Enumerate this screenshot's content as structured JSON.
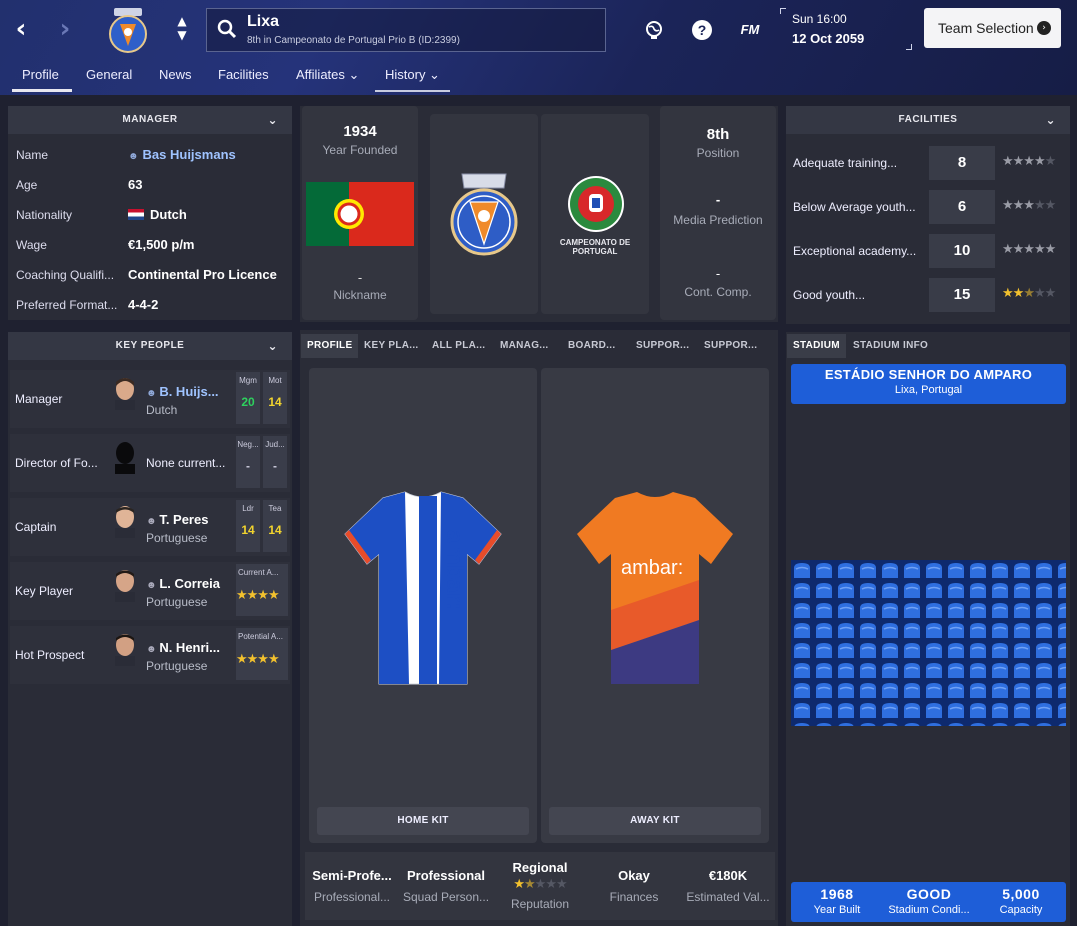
{
  "header": {
    "club_name": "Lixa",
    "club_subtitle": "8th in Campeonato de Portugal Prio B (ID:2399)",
    "fm_label": "FM",
    "help_label": "?",
    "time": "Sun 16:00",
    "date": "12 Oct 2059",
    "team_selection": "Team Selection"
  },
  "tabs": [
    {
      "label": "Profile",
      "active": true
    },
    {
      "label": "General"
    },
    {
      "label": "News"
    },
    {
      "label": "Facilities"
    },
    {
      "label": "Affiliates ⌄"
    },
    {
      "label": "History ⌄"
    }
  ],
  "manager_panel": {
    "title": "MANAGER",
    "rows": [
      {
        "label": "Name",
        "value": "Bas Huijsmans"
      },
      {
        "label": "Age",
        "value": "63"
      },
      {
        "label": "Nationality",
        "value": "Dutch"
      },
      {
        "label": "Wage",
        "value": "€1,500 p/m"
      },
      {
        "label": "Coaching Qualifi...",
        "value": "Continental Pro Licence"
      },
      {
        "label": "Preferred Format...",
        "value": "4-4-2"
      }
    ]
  },
  "club_info": {
    "year_founded": "1934",
    "year_founded_label": "Year Founded",
    "nickname": "-",
    "nickname_label": "Nickname",
    "position": "8th",
    "position_label": "Position",
    "media_prediction": "-",
    "media_prediction_label": "Media Prediction",
    "cont_comp": "-",
    "cont_comp_label": "Cont. Comp.",
    "league_logo_text": "CAMPEONATO DE PORTUGAL"
  },
  "facilities_panel": {
    "title": "FACILITIES",
    "rows": [
      {
        "label": "Adequate training...",
        "value": "8",
        "stars": 4
      },
      {
        "label": "Below Average youth...",
        "value": "6",
        "stars": 3
      },
      {
        "label": "Exceptional academy...",
        "value": "10",
        "stars": 5
      },
      {
        "label": "Good youth...",
        "value": "15",
        "stars": 2.5
      }
    ]
  },
  "key_people": {
    "title": "KEY PEOPLE",
    "rows": [
      {
        "role": "Manager",
        "name": "B. Huijs...",
        "nationality": "Dutch",
        "a1_head": "Mgm",
        "a1": "20",
        "a2_head": "Mot",
        "a2": "14"
      },
      {
        "role": "Director of Fo...",
        "none": "None current...",
        "a1_head": "Neg...",
        "a1": "-",
        "a2_head": "Jud...",
        "a2": "-"
      },
      {
        "role": "Captain",
        "name": "T. Peres",
        "nationality": "Portuguese",
        "a1_head": "Ldr",
        "a1": "14",
        "a2_head": "Tea",
        "a2": "14"
      },
      {
        "role": "Key Player",
        "name": "L. Correia",
        "nationality": "Portuguese",
        "wide_head": "Current A...",
        "stars": "★★★★"
      },
      {
        "role": "Hot Prospect",
        "name": "N. Henri...",
        "nationality": "Portuguese",
        "wide_head": "Potential A...",
        "stars": "★★★★"
      }
    ]
  },
  "subtabs": [
    "PROFILE",
    "KEY PLA...",
    "ALL PLA...",
    "MANAG...",
    "BOARD...",
    "SUPPOR...",
    "SUPPOR..."
  ],
  "kits": {
    "home_label": "HOME KIT",
    "away_label": "AWAY KIT",
    "sponsor": "ambar:"
  },
  "summary": [
    {
      "big": "Semi-Profe...",
      "small": "Professional..."
    },
    {
      "big": "Professional",
      "small": "Squad Person..."
    },
    {
      "big": "Regional",
      "small": "Reputation"
    },
    {
      "big": "Okay",
      "small": "Finances"
    },
    {
      "big": "€180K",
      "small": "Estimated Val..."
    }
  ],
  "stadium": {
    "tabs": [
      "STADIUM",
      "STADIUM INFO"
    ],
    "name": "ESTÁDIO SENHOR DO AMPARO",
    "location": "Lixa, Portugal",
    "year_built": "1968",
    "year_built_label": "Year Built",
    "condition": "GOOD",
    "condition_label": "Stadium Condi...",
    "capacity": "5,000",
    "capacity_label": "Capacity"
  },
  "colors": {
    "accent": "#1e5ed8",
    "link": "#9fc3ff",
    "attr_green": "#2ed15e",
    "attr_yellow": "#f2d42e",
    "star_gold": "#f2c12e"
  }
}
